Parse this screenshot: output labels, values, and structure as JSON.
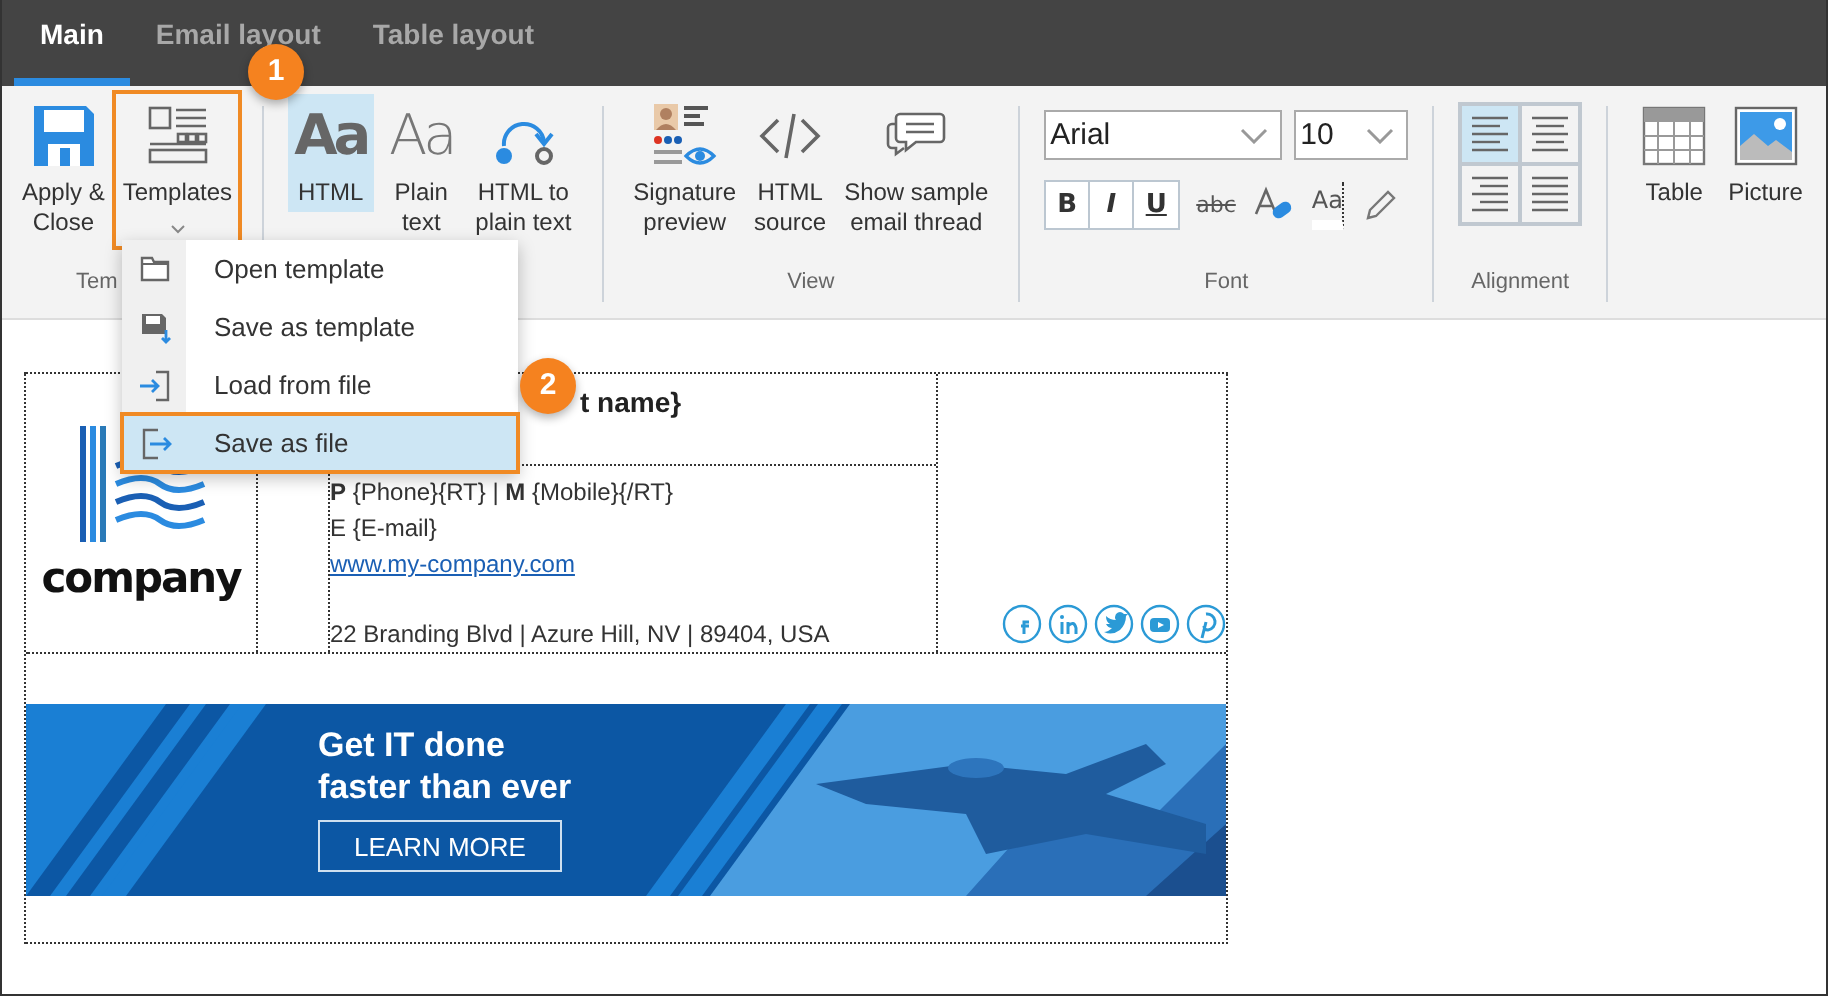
{
  "tabs": [
    {
      "label": "Main",
      "selected": true
    },
    {
      "label": "Email layout",
      "selected": false
    },
    {
      "label": "Table layout",
      "selected": false
    }
  ],
  "ribbon": {
    "groups": [
      {
        "label": "Tem",
        "clipped": true,
        "buttons": [
          {
            "kind": "save",
            "label": "Apply &\nClose",
            "selected": false
          },
          {
            "kind": "templates",
            "label": "Templates",
            "selected": false,
            "dropdown": true,
            "highlighted": true
          }
        ]
      },
      {
        "buttons": [
          {
            "kind": "bold-glyph",
            "glyph": "Aa",
            "label": "HTML",
            "selected": true
          },
          {
            "kind": "light-glyph",
            "glyph": "Aa",
            "label": "Plain\ntext",
            "selected": false
          },
          {
            "kind": "convert",
            "label": "HTML to\nplain text",
            "selected": false
          }
        ]
      },
      {
        "label": "View",
        "buttons": [
          {
            "kind": "preview",
            "label": "Signature\npreview",
            "selected": false
          },
          {
            "kind": "code",
            "label": "HTML\nsource",
            "selected": false
          },
          {
            "kind": "thread",
            "label": "Show sample\nemail thread",
            "selected": false
          }
        ]
      },
      {
        "label": "Font",
        "kind": "font",
        "font": "Arial",
        "size": "10",
        "styles": [
          {
            "kind": "bold",
            "glyph": "B"
          },
          {
            "kind": "italic",
            "glyph": "I"
          },
          {
            "kind": "underline",
            "glyph": "U"
          }
        ],
        "tools": [
          {
            "kind": "strike",
            "glyph": "abc"
          },
          {
            "kind": "highlight"
          },
          {
            "kind": "case",
            "glyph": "Aa"
          },
          {
            "kind": "pen"
          }
        ]
      },
      {
        "label": "Alignment",
        "kind": "align",
        "aligns": [
          {
            "kind": "left",
            "selected": true
          },
          {
            "kind": "center",
            "selected": false
          },
          {
            "kind": "right",
            "selected": false
          },
          {
            "kind": "justify",
            "selected": false
          }
        ]
      },
      {
        "buttons": [
          {
            "kind": "table",
            "label": "Table",
            "selected": false
          },
          {
            "kind": "picture",
            "label": "Picture",
            "selected": false
          }
        ]
      }
    ]
  },
  "menu": {
    "items": [
      {
        "kind": "open",
        "label": "Open template",
        "selected": false,
        "highlighted": false
      },
      {
        "kind": "save-template",
        "label": "Save as template",
        "selected": false,
        "highlighted": false
      },
      {
        "kind": "load",
        "label": "Load from file",
        "selected": false,
        "highlighted": false
      },
      {
        "kind": "save-file",
        "label": "Save as file",
        "selected": true,
        "highlighted": true
      }
    ]
  },
  "callouts": [
    {
      "number": "1"
    },
    {
      "number": "2"
    }
  ],
  "signature": {
    "logo_text": "company",
    "name": "t name}",
    "details": [
      "**P** {Phone}{RT} | **M** {Mobile}{/RT}",
      "E {E-mail}"
    ],
    "website": "www.my-company.com",
    "address": "22 Branding Blvd | Azure Hill, NV | 89404, USA",
    "socials": [
      {
        "kind": "facebook"
      },
      {
        "kind": "linkedin"
      },
      {
        "kind": "twitter"
      },
      {
        "kind": "youtube"
      },
      {
        "kind": "pinterest"
      }
    ],
    "banner": {
      "heading": "Get IT done\nfaster than ever",
      "button": "LEARN MORE"
    }
  }
}
